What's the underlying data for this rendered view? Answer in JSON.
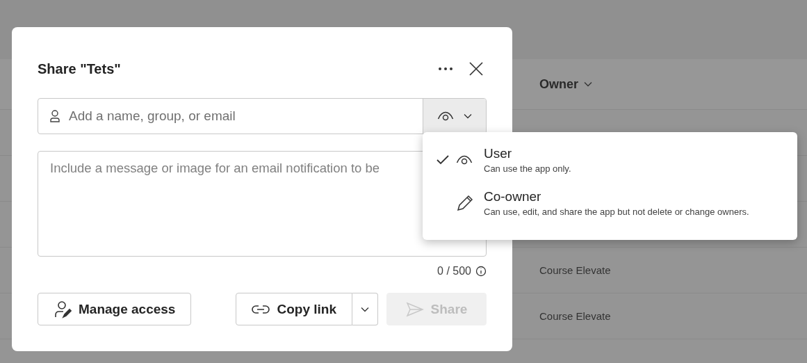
{
  "background_table": {
    "header": "Owner",
    "rows": [
      {},
      {},
      {},
      {
        "owner": "Course Elevate"
      },
      {
        "owner": "Course Elevate"
      },
      {}
    ]
  },
  "dialog": {
    "title": "Share \"Tets\"",
    "people_field": {
      "placeholder": "Add a name, group, or email"
    },
    "message_field": {
      "placeholder": "Include a message or image for an email notification to be"
    },
    "counter": "0 / 500",
    "buttons": [
      {
        "label": "Manage access",
        "kind": "manage",
        "disabled": false
      },
      {
        "label": "Copy link",
        "kind": "copy",
        "disabled": false
      },
      {
        "label": "Share",
        "kind": "share",
        "disabled": true
      }
    ]
  },
  "role_menu": {
    "items": [
      {
        "kind": "view",
        "title": "User",
        "description": "Can use the app only.",
        "selected": true
      },
      {
        "kind": "edit",
        "title": "Co-owner",
        "description": "Can use, edit, and share the app but not delete or change owners.",
        "selected": false
      }
    ]
  }
}
